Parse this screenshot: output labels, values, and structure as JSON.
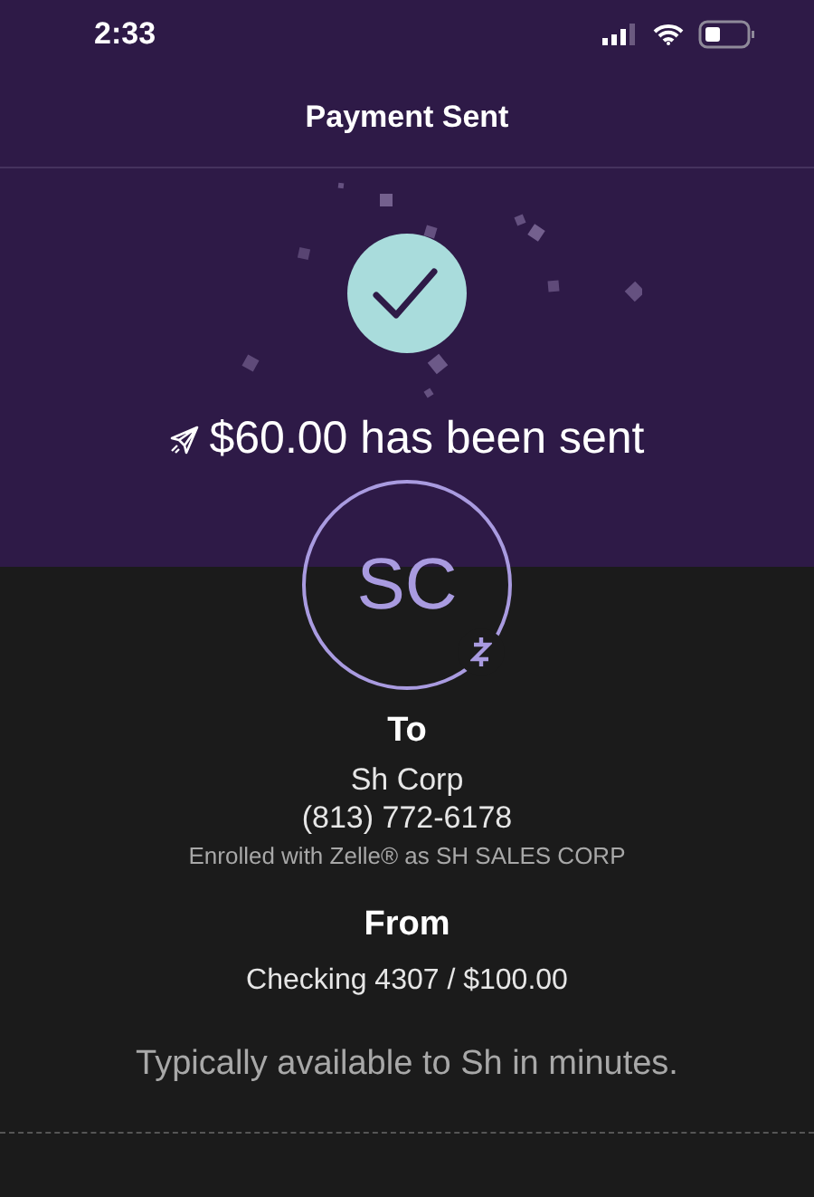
{
  "status_bar": {
    "time": "2:33"
  },
  "header": {
    "title": "Payment Sent"
  },
  "confirmation": {
    "amount_text": "$60.00 has been sent"
  },
  "recipient": {
    "initials": "SC",
    "label": "To",
    "name": "Sh Corp",
    "phone": "(813) 772-6178",
    "enrollment": "Enrolled with Zelle® as SH SALES CORP"
  },
  "source": {
    "label": "From",
    "account": "Checking 4307 / $100.00"
  },
  "availability_note": "Typically available to Sh in minutes."
}
